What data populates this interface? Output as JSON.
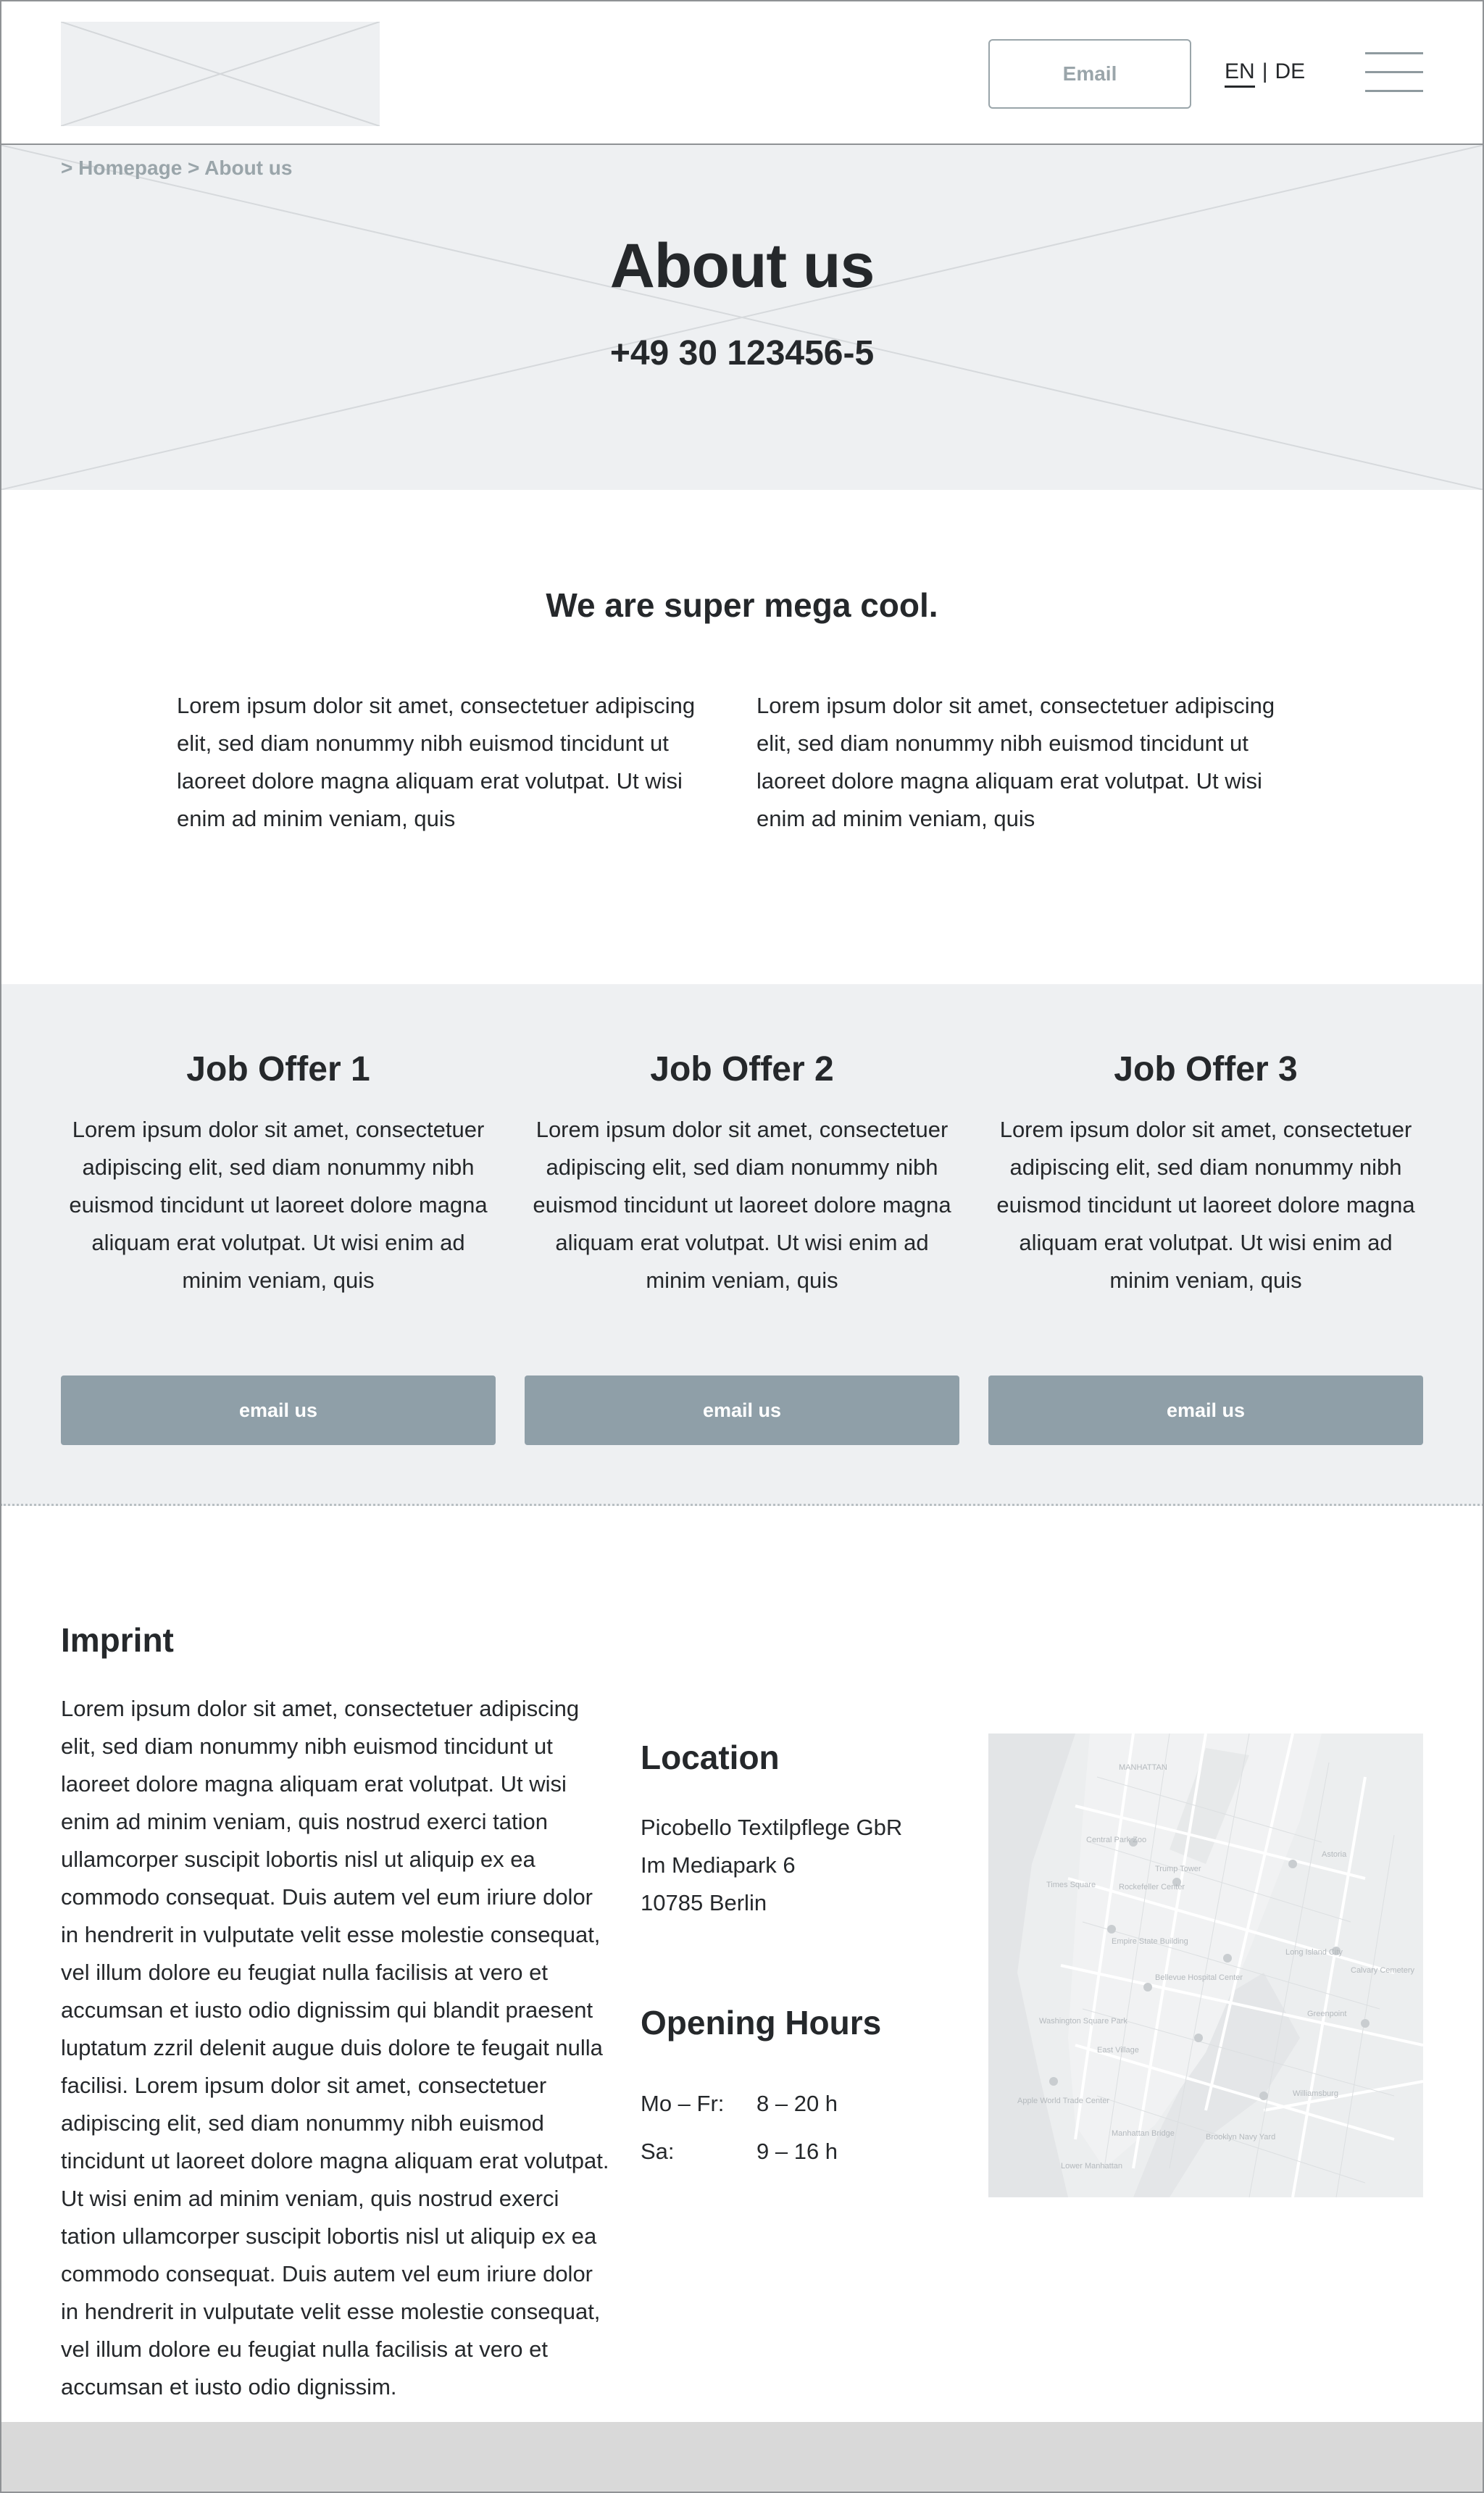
{
  "header": {
    "email_label": "Email",
    "lang_en": "EN",
    "lang_sep": "|",
    "lang_de": "DE",
    "logo_icon": "image-placeholder-icon",
    "menu_icon": "hamburger-menu-icon"
  },
  "hero": {
    "breadcrumb": "> Homepage > About us",
    "title": "About us",
    "phone": "+49 30 123456-5"
  },
  "intro": {
    "title": "We are super mega cool.",
    "col1": "Lorem ipsum dolor sit amet, consectetuer adipiscing elit, sed diam nonummy nibh euismod tincidunt ut laoreet dolore magna aliquam erat volutpat. Ut wisi enim ad minim veniam, quis",
    "col2": "Lorem ipsum dolor sit amet, consectetuer adipiscing elit, sed diam nonummy nibh euismod tincidunt ut laoreet dolore magna aliquam erat volutpat. Ut wisi enim ad minim veniam, quis"
  },
  "jobs": [
    {
      "title": "Job Offer 1",
      "text": "Lorem ipsum dolor sit amet, consectetuer adipiscing elit, sed diam nonummy nibh euismod tincidunt ut laoreet dolore magna aliquam erat volutpat. Ut wisi enim ad minim veniam, quis",
      "button": "email us"
    },
    {
      "title": "Job Offer 2",
      "text": "Lorem ipsum dolor sit amet, consectetuer adipiscing elit, sed diam nonummy nibh euismod tincidunt ut laoreet dolore magna aliquam erat volutpat. Ut wisi enim ad minim veniam, quis",
      "button": "email us"
    },
    {
      "title": "Job Offer 3",
      "text": "Lorem ipsum dolor sit amet, consectetuer adipiscing elit, sed diam nonummy nibh euismod tincidunt ut laoreet dolore magna aliquam erat volutpat. Ut wisi enim ad minim veniam, quis",
      "button": "email us"
    }
  ],
  "imprint": {
    "title": "Imprint",
    "text": "Lorem ipsum dolor sit amet, consectetuer adipiscing elit, sed diam nonummy nibh euismod tincidunt ut laoreet dolore magna aliquam erat volutpat. Ut wisi enim ad minim veniam, quis nostrud exerci tation ullamcorper suscipit lobortis nisl ut aliquip ex ea commodo consequat. Duis autem vel eum iriure dolor in hendrerit in vulputate velit esse molestie consequat, vel illum dolore eu feugiat nulla facilisis at vero et accumsan et iusto odio dignissim qui blandit praesent luptatum zzril delenit augue duis dolore te feugait nulla facilisi. Lorem ipsum dolor sit amet, consectetuer adipiscing elit, sed diam nonummy nibh euismod tincidunt ut laoreet dolore magna aliquam erat volutpat. Ut wisi enim ad minim veniam, quis nostrud exerci tation ullamcorper suscipit lobortis nisl ut aliquip ex ea commodo consequat. Duis autem vel eum iriure dolor in hendrerit in vulputate velit esse molestie consequat, vel illum dolore eu feugiat nulla facilisis at vero et accumsan et iusto odio dignissim."
  },
  "location": {
    "title": "Location",
    "lines": [
      "Picobello Textilpflege GbR",
      "Im Mediapark 6",
      "10785 Berlin"
    ]
  },
  "hours": {
    "title": "Opening Hours",
    "rows": [
      {
        "day": "Mo – Fr:",
        "time": "8 – 20 h"
      },
      {
        "day": "Sa:",
        "time": "9 – 16 h"
      }
    ]
  },
  "map": {
    "icon": "map-image-icon",
    "labels": [
      "MANHATTAN",
      "Central Park Zoo",
      "Trump Tower",
      "Times Square",
      "Rockefeller Center",
      "Empire State Building",
      "Bellevue Hospital Center",
      "Washington Square Park",
      "Apple World Trade Center",
      "Brooklyn Navy Yard",
      "Manhattan Bridge",
      "Williamsburg",
      "Long Island City",
      "Astoria",
      "Greenpoint",
      "Calvary Cemetery",
      "East Village",
      "Lower Manhattan"
    ]
  }
}
